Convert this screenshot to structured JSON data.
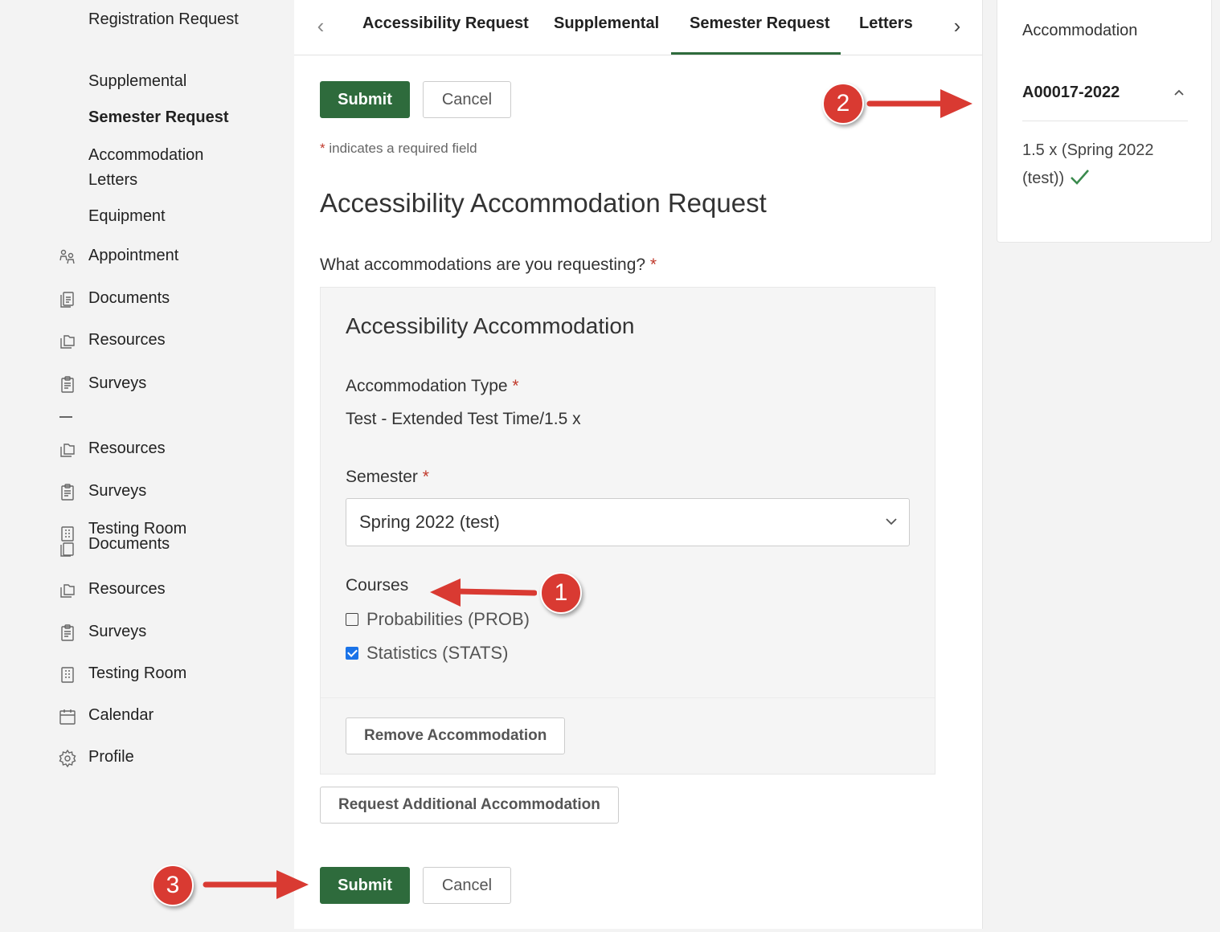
{
  "sidebar": {
    "items": [
      {
        "label": "Registration Request"
      },
      {
        "label": "Supplemental"
      },
      {
        "label": "Semester Request"
      },
      {
        "label": "Accommodation Letters"
      },
      {
        "label": "Equipment"
      },
      {
        "label": "Appointment",
        "icon": "appointment-icon"
      },
      {
        "label": "Documents",
        "icon": "documents-icon"
      },
      {
        "label": "Resources",
        "icon": "resources-icon"
      },
      {
        "label": "Surveys",
        "icon": "surveys-icon"
      },
      {
        "label": "Resources",
        "icon": "resources-icon"
      },
      {
        "label": "Surveys",
        "icon": "surveys-icon"
      },
      {
        "label": "Testing Room Documents",
        "icon": "testing-room-documents-icon"
      },
      {
        "label": "Resources",
        "icon": "resources-icon"
      },
      {
        "label": "Surveys",
        "icon": "surveys-icon"
      },
      {
        "label": "Testing Room",
        "icon": "testing-room-icon"
      },
      {
        "label": "Calendar",
        "icon": "calendar-icon"
      },
      {
        "label": "Profile",
        "icon": "gear-icon"
      }
    ]
  },
  "tabs": {
    "items": [
      {
        "label": "Accessibility Request"
      },
      {
        "label": "Supplemental"
      },
      {
        "label": "Semester Request",
        "active": true
      },
      {
        "label": "Letters"
      }
    ]
  },
  "form": {
    "submit_label": "Submit",
    "cancel_label": "Cancel",
    "required_note": "indicates a required field",
    "required_star": "*",
    "heading": "Accessibility Accommodation Request",
    "question": "What accommodations are you requesting?",
    "accommodation": {
      "title": "Accessibility Accommodation",
      "type_label": "Accommodation Type",
      "type_value": "Test - Extended Test Time/1.5 x",
      "semester_label": "Semester",
      "semester_value": "Spring 2022 (test)",
      "courses_label": "Courses",
      "courses": [
        {
          "label": "Probabilities (PROB)",
          "checked": false
        },
        {
          "label": "Statistics (STATS)",
          "checked": true
        }
      ],
      "remove_label": "Remove Accommodation"
    },
    "add_label": "Request Additional Accommodation"
  },
  "right_panel": {
    "title": "Accommodation",
    "id": "A00017-2022",
    "summary": "1.5 x (Spring 2022 (test))"
  },
  "annotations": {
    "badge1": "1",
    "badge2": "2",
    "badge3": "3"
  },
  "colors": {
    "primary_green": "#2e6b3c",
    "annotation_red": "#d93a32",
    "required_red": "#c0392b",
    "check_blue": "#1a73e8",
    "success_green": "#3a8a4d"
  }
}
